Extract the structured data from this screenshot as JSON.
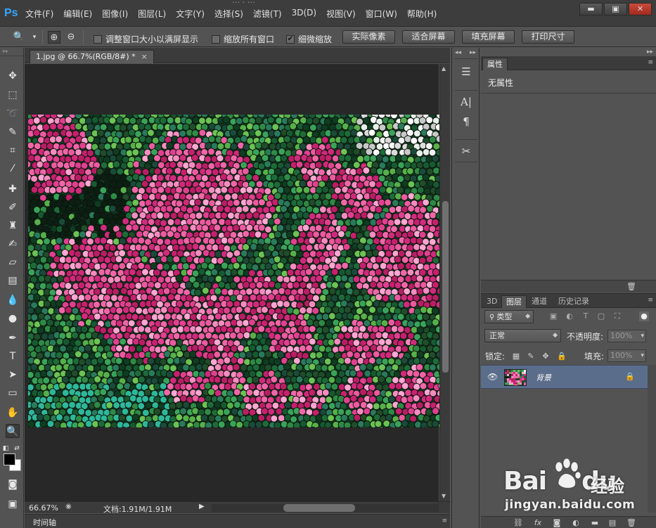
{
  "app": {
    "logo": "Ps",
    "title_fragment": "… : …",
    "menu": [
      "文件(F)",
      "编辑(E)",
      "图像(I)",
      "图层(L)",
      "文字(Y)",
      "选择(S)",
      "滤镜(T)",
      "3D(D)",
      "视图(V)",
      "窗口(W)",
      "帮助(H)"
    ],
    "window_controls": {
      "minimize": "▬",
      "maximize": "▣",
      "close": "✕"
    }
  },
  "options": {
    "tool_icon": "zoom-icon",
    "checkboxes": [
      {
        "label": "调整窗口大小以满屏显示",
        "checked": false
      },
      {
        "label": "缩放所有窗口",
        "checked": false
      },
      {
        "label": "细微缩放",
        "checked": true
      }
    ],
    "buttons": [
      "实际像素",
      "适合屏幕",
      "填充屏幕",
      "打印尺寸"
    ]
  },
  "document": {
    "tab_label": "1.jpg @ 66.7%(RGB/8#) *",
    "close": "×",
    "zoom": "66.67%",
    "size_info": "文档:1.91M/1.91M",
    "timeline_label": "时间轴"
  },
  "tools": [
    "move-tool",
    "marquee-tool",
    "lasso-tool",
    "quick-select-tool",
    "crop-tool",
    "eyedropper-tool",
    "healing-brush-tool",
    "brush-tool",
    "clone-stamp-tool",
    "history-brush-tool",
    "eraser-tool",
    "gradient-tool",
    "blur-tool",
    "dodge-tool",
    "pen-tool",
    "type-tool",
    "path-select-tool",
    "rectangle-tool",
    "hand-tool",
    "zoom-tool"
  ],
  "properties": {
    "tab": "属性",
    "empty_text": "无属性"
  },
  "layers": {
    "tabs": [
      "3D",
      "图层",
      "通道",
      "历史记录"
    ],
    "active_tab": "图层",
    "filter_kind": "类型",
    "blend_mode": "正常",
    "opacity_label": "不透明度:",
    "opacity_value": "100%",
    "lock_label": "锁定:",
    "fill_label": "填充:",
    "fill_value": "100%",
    "items": [
      {
        "name": "背景",
        "visible": true,
        "locked": true
      }
    ]
  },
  "watermark": {
    "brand": "Bai",
    "brand2": "du",
    "cn": "经验",
    "url": "jingyan.baidu.com"
  },
  "colors": {
    "foreground": "#000000",
    "background": "#ffffff",
    "ps_blue": "#31a8ff",
    "selected_layer": "#5a6d8b"
  }
}
